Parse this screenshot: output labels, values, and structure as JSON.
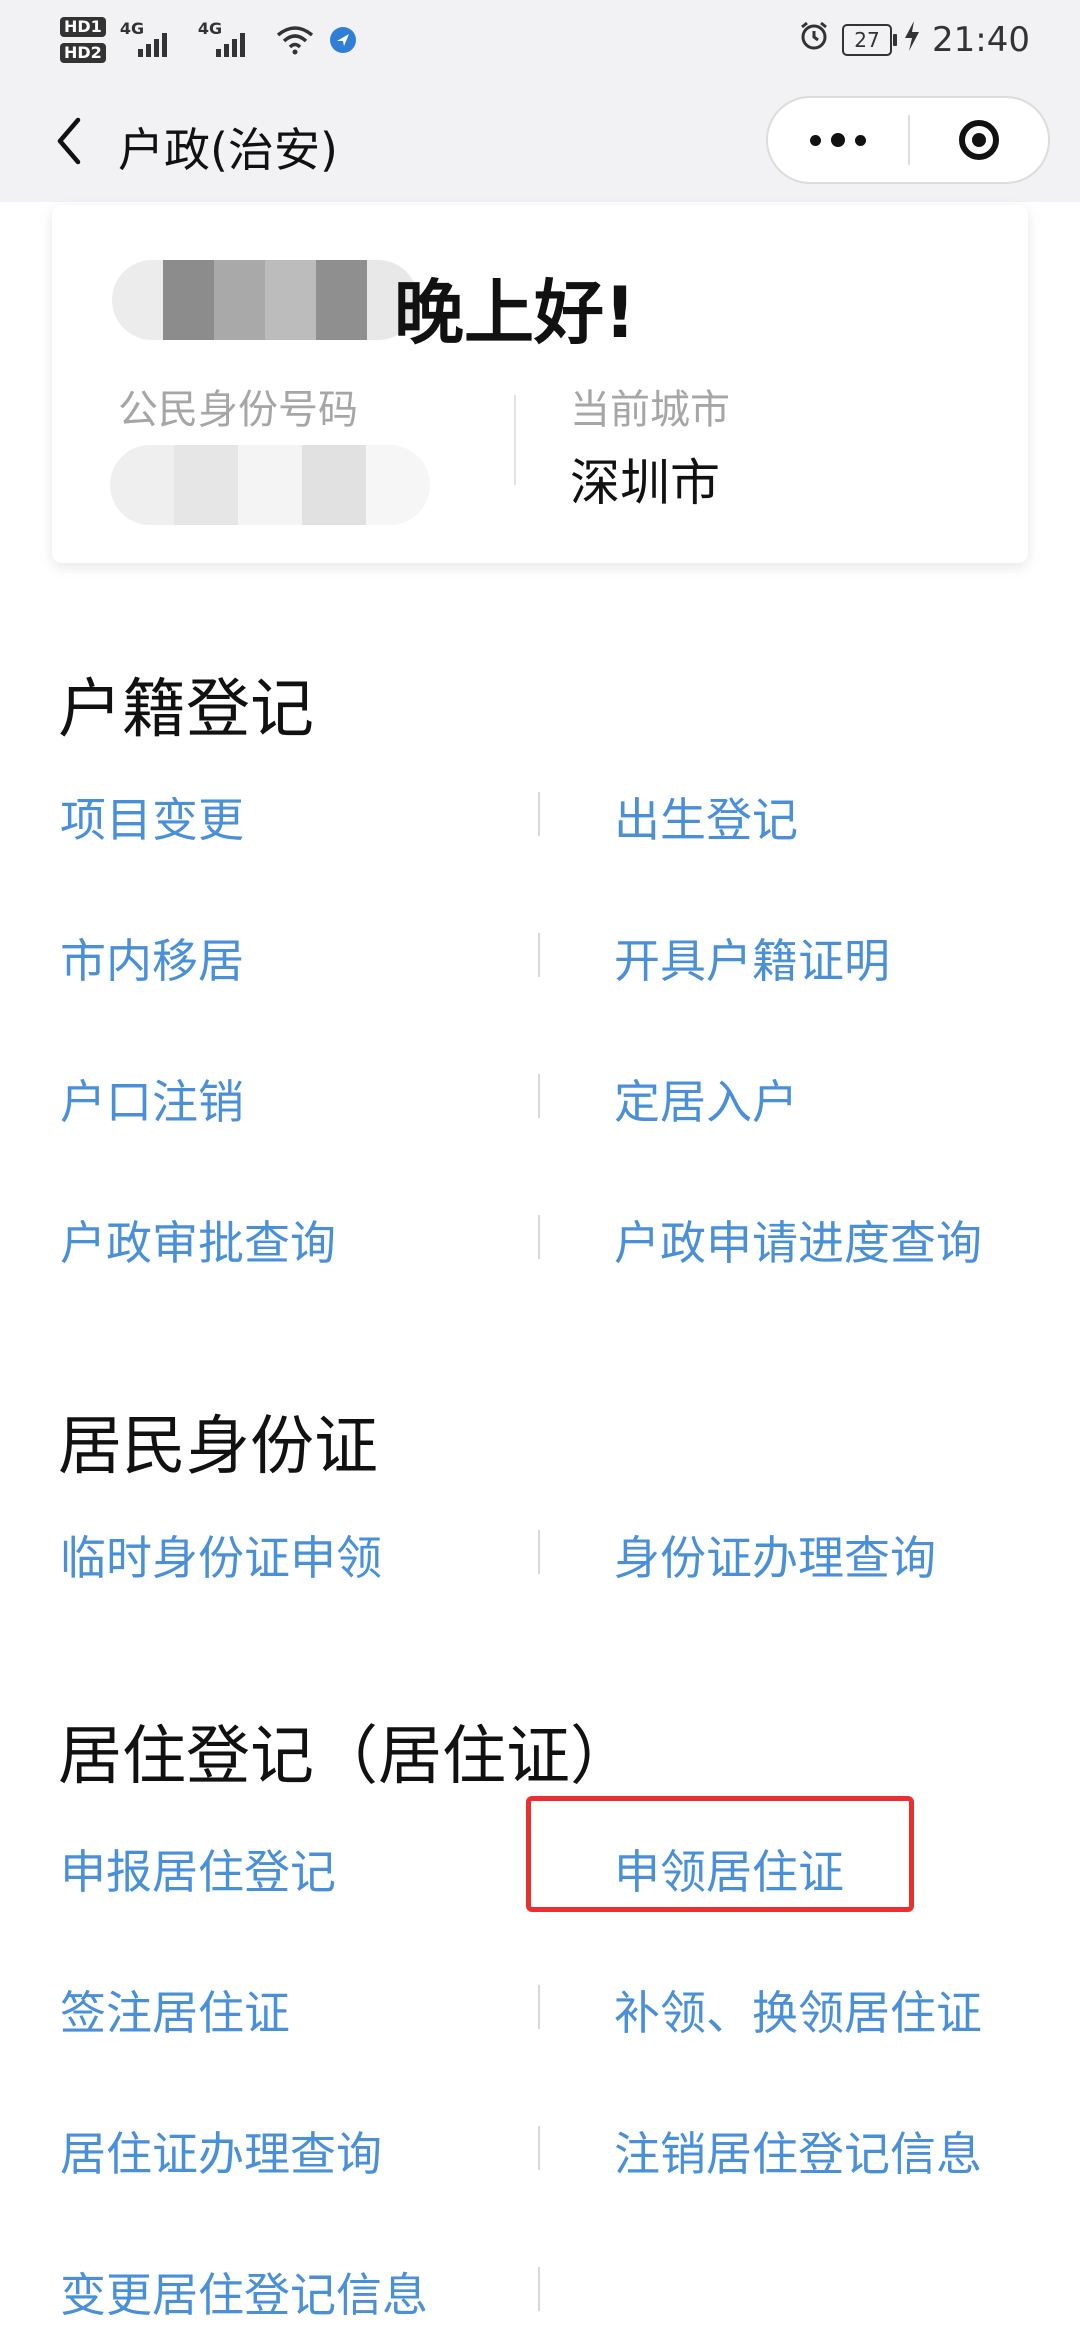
{
  "status_bar": {
    "hd1": "HD1",
    "hd2": "HD2",
    "net1": "4G",
    "net2": "4G",
    "battery": "27",
    "time": "21:40"
  },
  "nav": {
    "title": "户政(治安)"
  },
  "user_card": {
    "greeting": "晚上好!",
    "id_label": "公民身份号码",
    "city_label": "当前城市",
    "city_value": "深圳市"
  },
  "sections": [
    {
      "title": "户籍登记",
      "items": [
        "项目变更",
        "出生登记",
        "市内移居",
        "开具户籍证明",
        "户口注销",
        "定居入户",
        "户政审批查询",
        "户政申请进度查询"
      ]
    },
    {
      "title": "居民身份证",
      "items": [
        "临时身份证申领",
        "身份证办理查询"
      ]
    },
    {
      "title": "居住登记（居住证）",
      "items": [
        "申报居住登记",
        "申领居住证",
        "签注居住证",
        "补领、换领居住证",
        "居住证办理查询",
        "注销居住登记信息",
        "变更居住登记信息"
      ]
    }
  ],
  "colors": {
    "link": "#4a90d9",
    "highlight": "#e8302e"
  }
}
